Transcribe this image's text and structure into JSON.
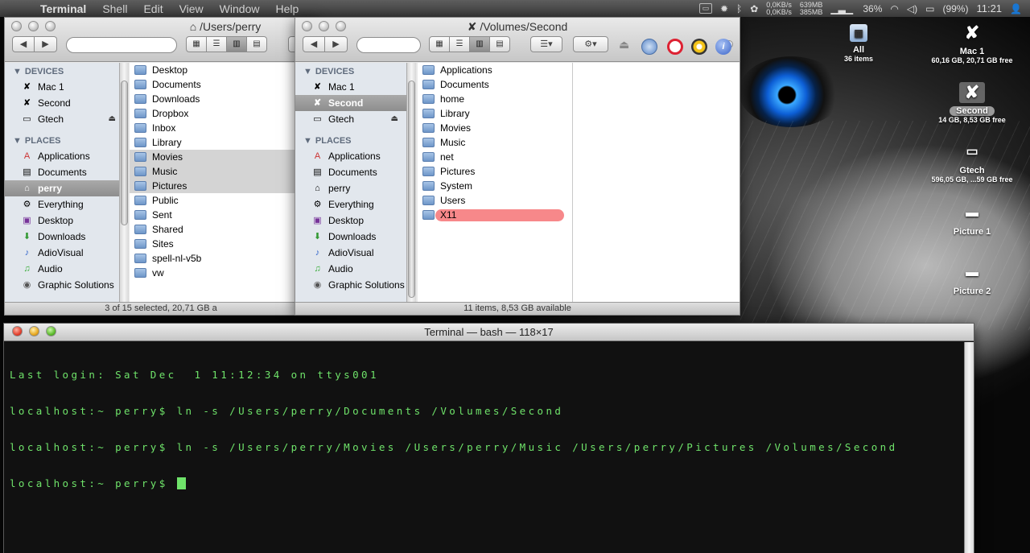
{
  "menubar": {
    "app": "Terminal",
    "items": [
      "Shell",
      "Edit",
      "View",
      "Window",
      "Help"
    ],
    "net_up": "0,0KB/s",
    "net_down": "0,0KB/s",
    "mem_used": "639MB",
    "mem_free": "385MB",
    "cpu": "36%",
    "battery": "(99%)",
    "clock": "11:21"
  },
  "finder1": {
    "title": "/Users/perry",
    "status": "3 of 15 selected, 20,71 GB a",
    "devices_header": "DEVICES",
    "devices": [
      "Mac 1",
      "Second",
      "Gtech"
    ],
    "places_header": "PLACES",
    "places": [
      "Applications",
      "Documents",
      "perry",
      "Everything",
      "Desktop",
      "Downloads",
      "AdioVisual",
      "Audio",
      "Graphic Solutions"
    ],
    "files": [
      "Desktop",
      "Documents",
      "Downloads",
      "Dropbox",
      "Inbox",
      "Library",
      "Movies",
      "Music",
      "Pictures",
      "Public",
      "Sent",
      "Shared",
      "Sites",
      "spell-nl-v5b",
      "vw"
    ]
  },
  "finder2": {
    "title": "/Volumes/Second",
    "status": "11 items, 8,53 GB available",
    "devices_header": "DEVICES",
    "devices": [
      "Mac 1",
      "Second",
      "Gtech"
    ],
    "places_header": "PLACES",
    "places": [
      "Applications",
      "Documents",
      "perry",
      "Everything",
      "Desktop",
      "Downloads",
      "AdioVisual",
      "Audio",
      "Graphic Solutions"
    ],
    "files": [
      "Applications",
      "Documents",
      "home",
      "Library",
      "Movies",
      "Music",
      "net",
      "Pictures",
      "System",
      "Users",
      "X11"
    ]
  },
  "desktop": {
    "all": {
      "label": "All",
      "sub": "36 items"
    },
    "mac1": {
      "label": "Mac 1",
      "sub": "60,16 GB, 20,71 GB free"
    },
    "second": {
      "label": "Second",
      "sub": "14 GB, 8,53 GB free"
    },
    "gtech": {
      "label": "Gtech",
      "sub": "596,05 GB, ...59 GB free"
    },
    "pic1": {
      "label": "Picture 1"
    },
    "pic2": {
      "label": "Picture 2"
    }
  },
  "terminal": {
    "title": "Terminal — bash — 118×17",
    "lines": [
      "Last login: Sat Dec  1 11:12:34 on ttys001",
      "localhost:~ perry$ ln -s /Users/perry/Documents /Volumes/Second",
      "localhost:~ perry$ ln -s /Users/perry/Movies /Users/perry/Music /Users/perry/Pictures /Volumes/Second",
      "localhost:~ perry$ "
    ]
  },
  "colors": {
    "selection_red": "#f7888a",
    "terminal_green": "#6fe36a"
  }
}
